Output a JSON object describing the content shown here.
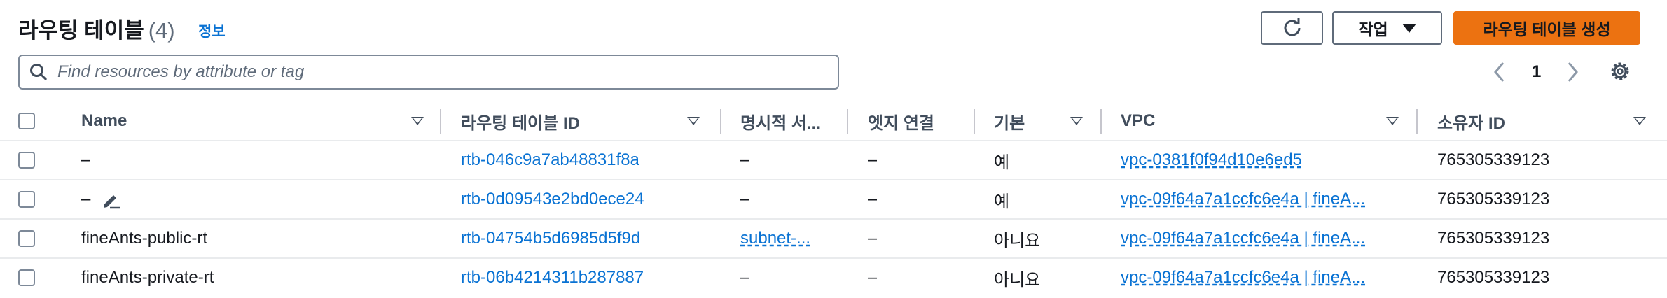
{
  "header": {
    "title": "라우팅 테이블",
    "count": "(4)",
    "info_link": "정보",
    "actions_label": "작업",
    "create_label": "라우팅 테이블 생성"
  },
  "search": {
    "placeholder": "Find resources by attribute or tag"
  },
  "pagination": {
    "current_page": "1"
  },
  "table": {
    "columns": [
      "Name",
      "라우팅 테이블 ID",
      "명시적 서...",
      "엣지 연결",
      "기본",
      "VPC",
      "소유자 ID"
    ],
    "rows": [
      {
        "name": "–",
        "rtb_id": "rtb-046c9a7ab48831f8a",
        "explicit": "–",
        "edge": "–",
        "main": "예",
        "vpc": "vpc-0381f0f94d10e6ed5",
        "owner": "765305339123"
      },
      {
        "name": "–",
        "rtb_id": "rtb-0d09543e2bd0ece24",
        "explicit": "–",
        "edge": "–",
        "main": "예",
        "vpc": "vpc-09f64a7a1ccfc6e4a | fineA...",
        "owner": "765305339123"
      },
      {
        "name": "fineAnts-public-rt",
        "rtb_id": "rtb-04754b5d6985d5f9d",
        "explicit": "subnet-...",
        "edge": "–",
        "main": "아니요",
        "vpc": "vpc-09f64a7a1ccfc6e4a | fineA...",
        "owner": "765305339123"
      },
      {
        "name": "fineAnts-private-rt",
        "rtb_id": "rtb-06b4214311b287887",
        "explicit": "–",
        "edge": "–",
        "main": "아니요",
        "vpc": "vpc-09f64a7a1ccfc6e4a | fineA...",
        "owner": "765305339123"
      }
    ]
  },
  "colors": {
    "accent": "#ec7211",
    "link": "#0972d3",
    "text": "#16191f",
    "muted": "#414d5c"
  },
  "icons": [
    "refresh-icon",
    "caret-down-icon",
    "search-icon",
    "chevron-left-icon",
    "chevron-right-icon",
    "gear-icon",
    "edit-icon",
    "sort-icon"
  ]
}
